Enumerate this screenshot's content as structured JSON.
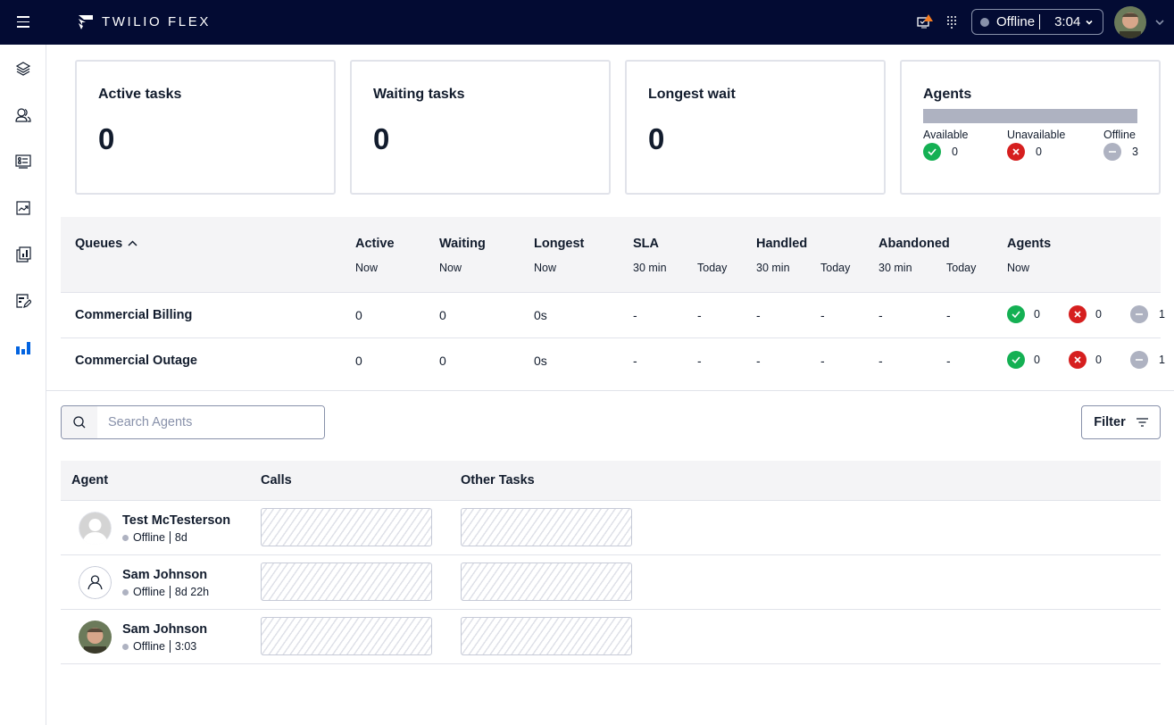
{
  "header": {
    "app_title": "TWILIO FLEX",
    "status": "Offline",
    "timer": "3:04",
    "icons": [
      "menu-icon",
      "twilio-logo-icon",
      "alert-monitor-icon",
      "dialpad-icon",
      "chevron-down-icon",
      "user-avatar"
    ]
  },
  "sidebar": {
    "items": [
      {
        "name": "layers",
        "icon": "layers-icon",
        "active": false
      },
      {
        "name": "teams",
        "icon": "users-icon",
        "active": false
      },
      {
        "name": "tasks",
        "icon": "task-list-icon",
        "active": false
      },
      {
        "name": "insights",
        "icon": "chart-trend-icon",
        "active": false
      },
      {
        "name": "reports",
        "icon": "report-icon",
        "active": false
      },
      {
        "name": "edit",
        "icon": "edit-form-icon",
        "active": false
      },
      {
        "name": "queues-stats",
        "icon": "bar-chart-icon",
        "active": true
      }
    ],
    "active_color": "#0263e0"
  },
  "cards": [
    {
      "title": "Active tasks",
      "value": "0"
    },
    {
      "title": "Waiting tasks",
      "value": "0"
    },
    {
      "title": "Longest wait",
      "value": "0"
    }
  ],
  "agents_card": {
    "title": "Agents",
    "available_label": "Available",
    "available": "0",
    "unavailable_label": "Unavailable",
    "unavailable": "0",
    "offline_label": "Offline",
    "offline": "3"
  },
  "queues": {
    "headers": {
      "queues": "Queues",
      "active": "Active",
      "waiting": "Waiting",
      "longest": "Longest",
      "sla": "SLA",
      "handled": "Handled",
      "abandoned": "Abandoned",
      "agents": "Agents"
    },
    "sub": {
      "now": "Now",
      "min30": "30 min",
      "today": "Today"
    },
    "rows": [
      {
        "name": "Commercial Billing",
        "active": "0",
        "waiting": "0",
        "longest": "0s",
        "sla30": "-",
        "slaToday": "-",
        "handled30": "-",
        "handledToday": "-",
        "abandoned30": "-",
        "abandonedToday": "-",
        "available": "0",
        "unavailable": "0",
        "offline": "1"
      },
      {
        "name": "Commercial Outage",
        "active": "0",
        "waiting": "0",
        "longest": "0s",
        "sla30": "-",
        "slaToday": "-",
        "handled30": "-",
        "handledToday": "-",
        "abandoned30": "-",
        "abandonedToday": "-",
        "available": "0",
        "unavailable": "0",
        "offline": "1"
      }
    ]
  },
  "search": {
    "placeholder": "Search Agents",
    "value": ""
  },
  "filter_label": "Filter",
  "agents_table": {
    "headers": {
      "agent": "Agent",
      "calls": "Calls",
      "other": "Other Tasks"
    },
    "rows": [
      {
        "name": "Test McTesterson",
        "status": "Offline",
        "duration": "8d",
        "avatar": "default-avatar"
      },
      {
        "name": "Sam Johnson",
        "status": "Offline",
        "duration": "8d 22h",
        "avatar": "user-outline-icon"
      },
      {
        "name": "Sam Johnson",
        "status": "Offline",
        "duration": "3:03",
        "avatar": "photo-avatar"
      }
    ]
  },
  "colors": {
    "topbar": "#030b33",
    "available": "#14b053",
    "unavailable": "#d61f1f",
    "offline": "#aeb2c1"
  }
}
